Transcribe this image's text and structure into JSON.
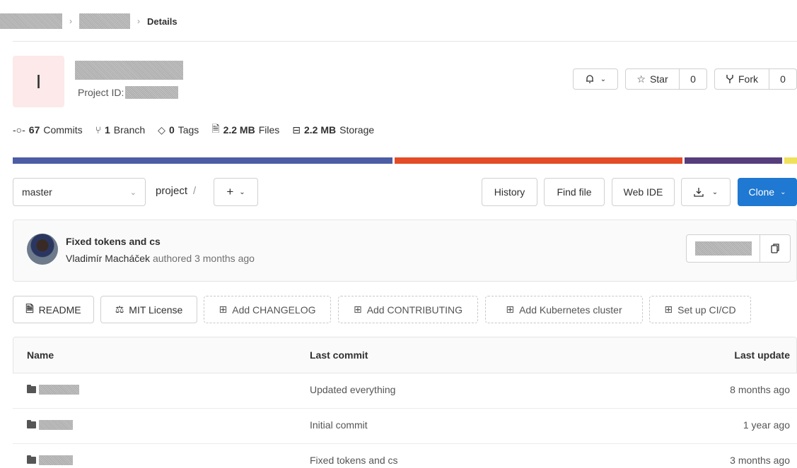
{
  "breadcrumb": {
    "current": "Details"
  },
  "project": {
    "avatar_letter": "I",
    "id_label": "Project ID:"
  },
  "actions": {
    "notification_icon": "bell-icon",
    "star_label": "Star",
    "star_count": "0",
    "fork_label": "Fork",
    "fork_count": "0"
  },
  "stats": {
    "commits_count": "67",
    "commits_label": "Commits",
    "branches_count": "1",
    "branches_label": "Branch",
    "tags_count": "0",
    "tags_label": "Tags",
    "files_size": "2.2 MB",
    "files_label": "Files",
    "storage_size": "2.2 MB",
    "storage_label": "Storage"
  },
  "language_bar": [
    {
      "color": "#4d5da4",
      "fraction": 0.488
    },
    {
      "color": "#e34c26",
      "fraction": 0.37
    },
    {
      "color": "#563d7c",
      "fraction": 0.126
    },
    {
      "color": "#f1e05a",
      "fraction": 0.016
    }
  ],
  "toolbar": {
    "branch": "master",
    "path": "project",
    "path_sep": "/",
    "plus": "+",
    "history": "History",
    "find_file": "Find file",
    "web_ide": "Web IDE",
    "clone": "Clone"
  },
  "last_commit": {
    "title": "Fixed tokens and cs",
    "author": "Vladimír Macháček",
    "meta": "authored 3 months ago"
  },
  "quick_buttons": {
    "readme": "README",
    "license": "MIT License",
    "changelog": "Add CHANGELOG",
    "contributing": "Add CONTRIBUTING",
    "kubernetes": "Add Kubernetes cluster",
    "cicd": "Set up CI/CD"
  },
  "table": {
    "headers": {
      "name": "Name",
      "last_commit": "Last commit",
      "last_update": "Last update"
    },
    "rows": [
      {
        "commit": "Updated everything",
        "updated": "8 months ago"
      },
      {
        "commit": "Initial commit",
        "updated": "1 year ago"
      },
      {
        "commit": "Fixed tokens and cs",
        "updated": "3 months ago"
      }
    ]
  }
}
